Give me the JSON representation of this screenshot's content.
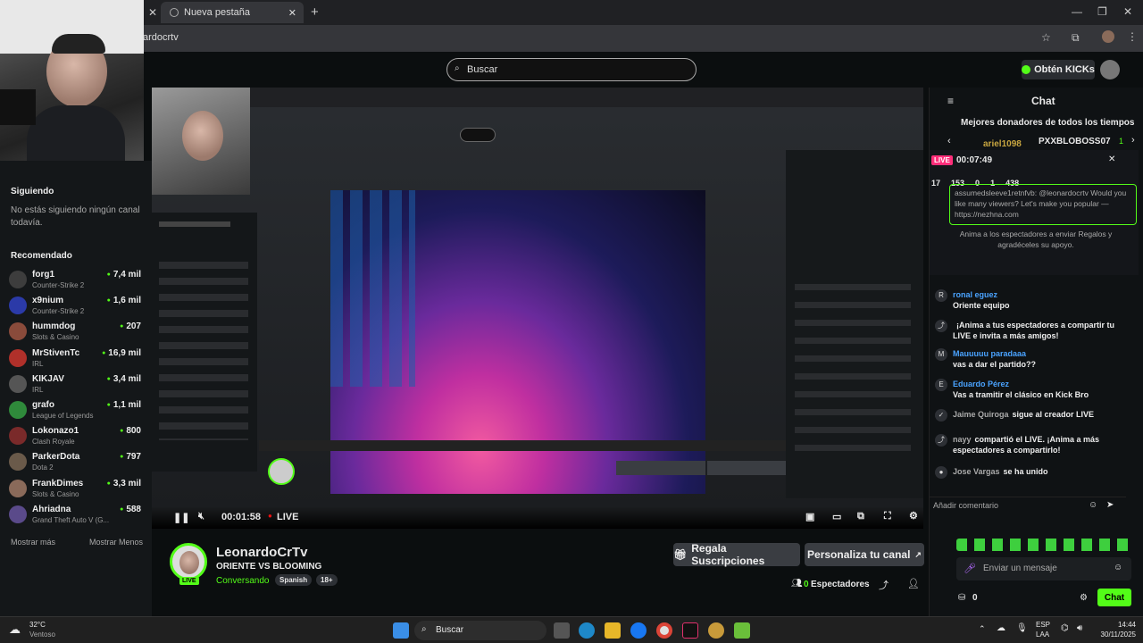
{
  "browser": {
    "tab_title": "Nueva pestaña",
    "url_fragment": "ardocrtv"
  },
  "header": {
    "search_placeholder": "Buscar",
    "kicks_label": "Obtén KICKs"
  },
  "sidebar": {
    "following_title": "Siguiendo",
    "following_empty": "No estás siguiendo ningún canal todavía.",
    "recommended_title": "Recomendado",
    "channels": [
      {
        "name": "forg1",
        "game": "Counter-Strike 2",
        "viewers": "7,4 mil",
        "color": "#3d3d3d"
      },
      {
        "name": "x9nium",
        "game": "Counter-Strike 2",
        "viewers": "1,6 mil",
        "color": "#2b3aa8"
      },
      {
        "name": "hummdog",
        "game": "Slots & Casino",
        "viewers": "207",
        "color": "#8a4b3b"
      },
      {
        "name": "MrStivenTc",
        "game": "IRL",
        "viewers": "16,9 mil",
        "color": "#b0302a"
      },
      {
        "name": "KIKJAV",
        "game": "IRL",
        "viewers": "3,4 mil",
        "color": "#555"
      },
      {
        "name": "grafo",
        "game": "League of Legends",
        "viewers": "1,1 mil",
        "color": "#2f8a3b"
      },
      {
        "name": "Lokonazo1",
        "game": "Clash Royale",
        "viewers": "800",
        "color": "#7a2a2a"
      },
      {
        "name": "ParkerDota",
        "game": "Dota 2",
        "viewers": "797",
        "color": "#6a5a4a"
      },
      {
        "name": "FrankDimes",
        "game": "Slots & Casino",
        "viewers": "3,3 mil",
        "color": "#8a6a5a"
      },
      {
        "name": "Ahriadna",
        "game": "Grand Theft Auto V (G...",
        "viewers": "588",
        "color": "#5a4a8a"
      }
    ],
    "show_more": "Mostrar más",
    "show_less": "Mostrar Menos"
  },
  "player": {
    "elapsed": "00:01:58",
    "live_label": "LIVE"
  },
  "stream": {
    "channel": "LeonardoCrTv",
    "title": "ORIENTE VS BLOOMING",
    "category": "Conversando",
    "language": "Spanish",
    "rating": "18+",
    "live_badge": "LIVE",
    "gift_subs": "Regala Suscripciones",
    "customize": "Personaliza tu canal",
    "viewers_count": "0",
    "viewers_label": "Espectadores"
  },
  "chat": {
    "title": "Chat",
    "top_donors": "Mejores donadores de todos los tiempos",
    "donor1": "ariel1098",
    "donor2": "PXXBLOBOSS07",
    "donor2_count": "1",
    "mini_live": "LIVE",
    "mini_time": "00:07:49",
    "stats": [
      "17",
      "153",
      "0",
      "1",
      "438"
    ],
    "pinned_text": "assumedsleeve1retnfvb: @leonardocrtv Would you like many viewers? Let's make you popular — https://nezhna.com",
    "gift_hint": "Anima a los espectadores a enviar Regalos y agradéceles su apoyo.",
    "messages": [
      {
        "user": "ronal eguez",
        "text": "Oriente equipo",
        "user_color": "#4aa3ff"
      },
      {
        "user": "",
        "text": "¡Anima a tus espectadores a compartir tu LIVE e invita a más amigos!",
        "user_color": "#eee"
      },
      {
        "user": "Mauuuuu paradaaa",
        "text": "vas a dar el partido??",
        "user_color": "#4aa3ff"
      },
      {
        "user": "Eduardo Pérez",
        "text": "Vas a tramitir el clásico en Kick Bro",
        "user_color": "#4aa3ff"
      },
      {
        "user": "Jaime Quiroga",
        "text": "sigue al creador LIVE",
        "user_color": "#aaa"
      },
      {
        "user": "nayy",
        "text": "compartió el LIVE. ¡Anima a más espectadores a compartirlo!",
        "user_color": "#aaa"
      },
      {
        "user": "Jose Vargas",
        "text": "se ha unido",
        "user_color": "#aaa"
      }
    ],
    "add_comment": "Añadir comentario",
    "send_placeholder": "Enviar un mensaje",
    "points": "0",
    "chat_button": "Chat"
  },
  "taskbar": {
    "weather_temp": "32°C",
    "weather_desc": "Ventoso",
    "search": "Buscar",
    "lang1": "ESP",
    "lang2": "LAA",
    "time": "14:44",
    "date": "30/11/2025"
  },
  "colors": {
    "kick_green": "#53fc18",
    "bg": "#0b0e0f"
  }
}
